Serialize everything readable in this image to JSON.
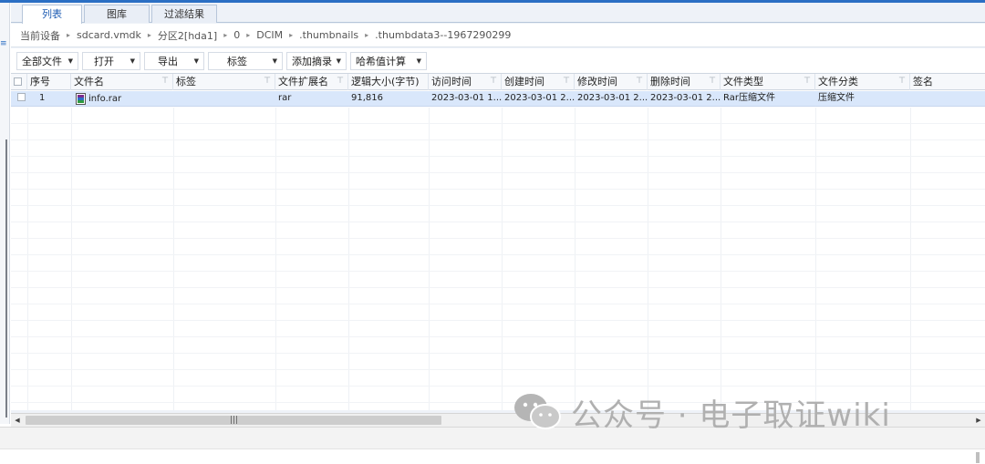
{
  "tabs": [
    "列表",
    "图库",
    "过滤结果"
  ],
  "breadcrumb": [
    "当前设备",
    "sdcard.vmdk",
    "分区2[hda1]",
    "0",
    "DCIM",
    ".thumbnails",
    ".thumbdata3--1967290299"
  ],
  "toolbar": [
    "全部文件",
    "打开",
    "导出",
    "标签",
    "添加摘录",
    "哈希值计算"
  ],
  "columns": [
    "序号",
    "文件名",
    "标签",
    "文件扩展名",
    "逻辑大小(字节)",
    "访问时间",
    "创建时间",
    "修改时间",
    "删除时间",
    "文件类型",
    "文件分类",
    "签名"
  ],
  "rows": [
    {
      "index": "1",
      "filename": "info.rar",
      "tag": "",
      "ext": "rar",
      "size": "91,816",
      "accessed": "2023-03-01 1...",
      "created": "2023-03-01 2...",
      "modified": "2023-03-01 2...",
      "deleted": "2023-03-01 2...",
      "filetype": "Rar压缩文件",
      "category": "压缩文件",
      "signature": ""
    }
  ],
  "watermark": "公众号 · 电子取证wiki",
  "colors": {
    "accent": "#2b6fc4",
    "selected_row": "#d9e7fb",
    "active_tab_text": "#1f5db3"
  },
  "icons": [
    "filter-icon",
    "dropdown-caret-icon",
    "rar-file-icon",
    "wechat-icon",
    "scroll-left-icon",
    "scroll-right-icon"
  ]
}
